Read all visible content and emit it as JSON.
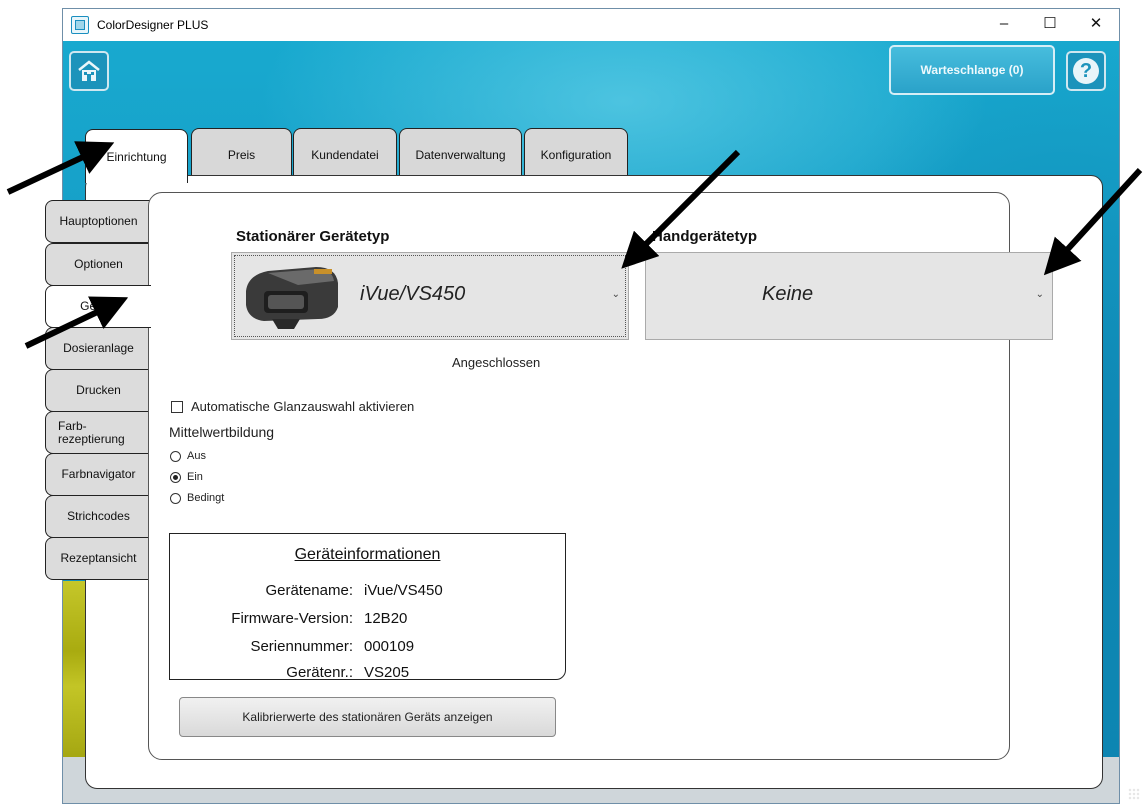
{
  "window": {
    "title": "ColorDesigner PLUS",
    "controls": {
      "minimize": "–",
      "maximize": "☐",
      "close": "✕"
    }
  },
  "header": {
    "queue_label": "Warteschlange (0)",
    "help_label": "?"
  },
  "top_tabs": [
    {
      "label": "Einrichtung",
      "active": true
    },
    {
      "label": "Preis",
      "active": false
    },
    {
      "label": "Kundendatei",
      "active": false
    },
    {
      "label": "Datenverwaltung",
      "active": false
    },
    {
      "label": "Konfiguration",
      "active": false
    }
  ],
  "side_tabs": [
    {
      "label": "Hauptoptionen",
      "active": false
    },
    {
      "label": "Optionen",
      "active": false
    },
    {
      "label": "Geräte",
      "active": true
    },
    {
      "label": "Dosieranlage",
      "active": false
    },
    {
      "label": "Drucken",
      "active": false
    },
    {
      "label": "Farb-\nrezeptierung",
      "active": false
    },
    {
      "label": "Farbnavigator",
      "active": false
    },
    {
      "label": "Strichcodes",
      "active": false
    },
    {
      "label": "Rezeptansicht",
      "active": false
    }
  ],
  "stationary": {
    "title": "Stationärer Gerätetyp",
    "selected": "iVue/VS450",
    "status": "Angeschlossen"
  },
  "handheld": {
    "title": "Handgerätetyp",
    "selected": "Keine"
  },
  "gloss_checkbox": {
    "label": "Automatische Glanzauswahl aktivieren",
    "checked": false
  },
  "averaging": {
    "label": "Mittelwertbildung",
    "options": [
      {
        "label": "Aus",
        "selected": false
      },
      {
        "label": "Ein",
        "selected": true
      },
      {
        "label": "Bedingt",
        "selected": false
      }
    ]
  },
  "device_info": {
    "title": "Geräteinformationen",
    "rows": [
      {
        "key": "Gerätename:",
        "value": "iVue/VS450"
      },
      {
        "key": "Firmware-Version:",
        "value": "12B20"
      },
      {
        "key": "Seriennummer:",
        "value": "000109"
      },
      {
        "key": "Gerätenr.:",
        "value": "VS205"
      }
    ]
  },
  "calibration_button": "Kalibrierwerte des stationären Geräts anzeigen",
  "icons": {
    "home": "home-icon",
    "help": "help-icon",
    "device": "spectrophotometer-icon",
    "chevron": "chevron-down-icon"
  },
  "colors": {
    "header_accent": "#1aa1c6",
    "panel": "#ffffff"
  }
}
